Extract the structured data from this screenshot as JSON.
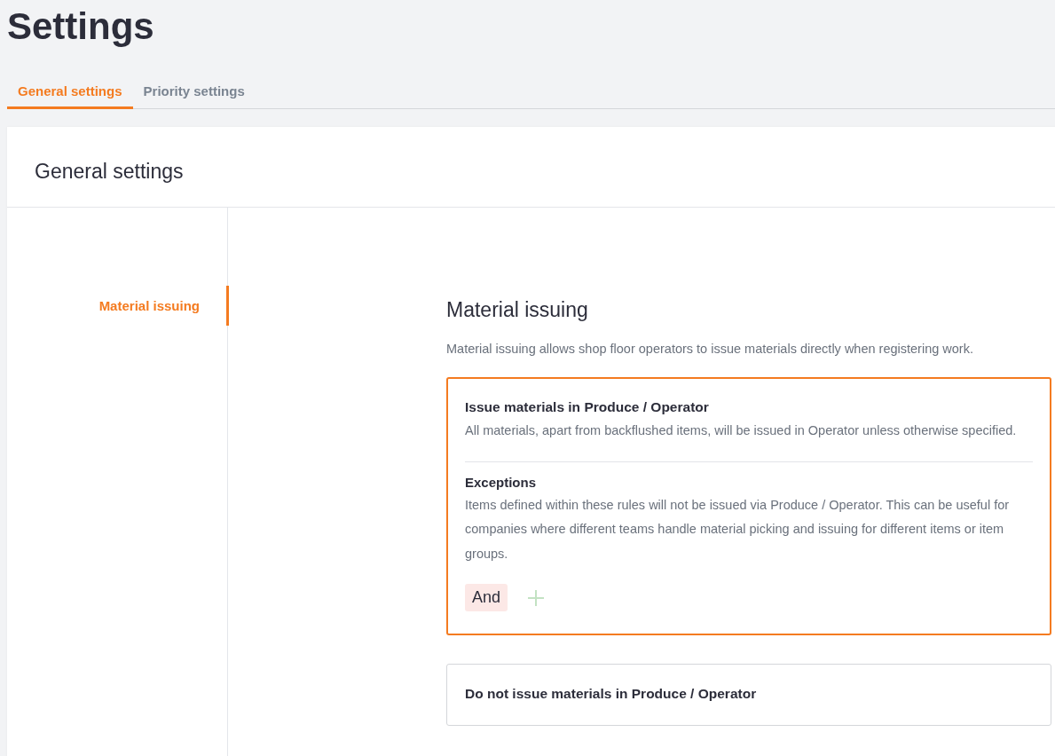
{
  "page_title": "Settings",
  "tabs": [
    {
      "label": "General settings",
      "selected": true
    },
    {
      "label": "Priority settings",
      "selected": false
    }
  ],
  "panel": {
    "title": "General settings",
    "nav": [
      {
        "label": "Material issuing",
        "selected": true
      }
    ],
    "section": {
      "title": "Material issuing",
      "description": "Material issuing allows shop floor operators to issue materials directly when registering work.",
      "options": [
        {
          "selected": true,
          "title": "Issue materials in Produce / Operator",
          "description": "All materials, apart from backflushed items, will be issued in Operator unless otherwise specified.",
          "exceptions": {
            "title": "Exceptions",
            "description": "Items defined within these rules will not be issued via Produce / Operator. This can be useful for companies where different teams handle material picking and issuing for different items or item groups.",
            "operator": "And"
          }
        },
        {
          "selected": false,
          "title": "Do not issue materials in Produce / Operator"
        }
      ]
    }
  }
}
